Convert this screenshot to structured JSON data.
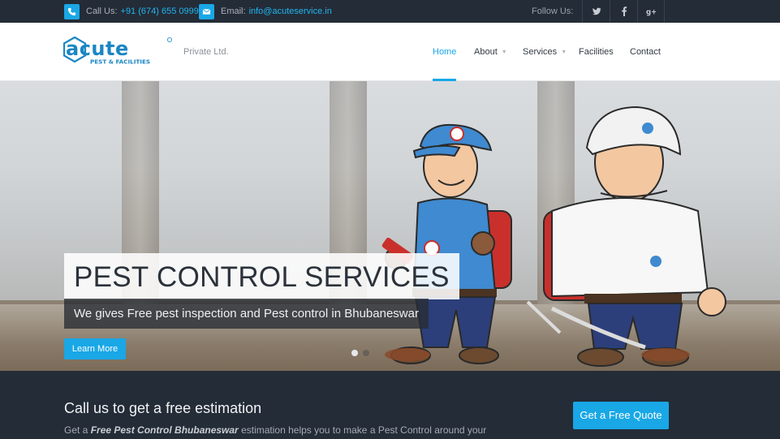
{
  "topbar": {
    "phone_label": "Call Us:",
    "phone_value": "+91 (674) 655 0999",
    "email_label": "Email:",
    "email_value": "info@acuteservice.in",
    "follow_label": "Follow Us:",
    "social_icons": [
      "twitter-icon",
      "facebook-icon",
      "google-plus-icon"
    ]
  },
  "header": {
    "logo_word": "acute",
    "logo_sub": "PEST & FACILITIES",
    "tagline": "Private Ltd.",
    "nav": [
      {
        "label": "Home",
        "active": true
      },
      {
        "label": "About",
        "dropdown": true
      },
      {
        "label": "Services",
        "dropdown": true
      },
      {
        "label": "Facilities"
      },
      {
        "label": "Contact"
      }
    ]
  },
  "hero": {
    "headline": "PEST CONTROL SERVICES",
    "subline": "We gives Free pest inspection and Pest control in Bhubaneswar",
    "button": "Learn More",
    "slides_total": 2,
    "active_slide": 1
  },
  "band": {
    "title": "Call us to get a free estimation",
    "desc_prefix": "Get a ",
    "desc_bold": "Free Pest Control Bhubaneswar",
    "desc_suffix": " estimation helps you to make a Pest Control around your",
    "button": "Get a Free Quote"
  },
  "colors": {
    "accent": "#19a7e6",
    "dark_bar": "#242c37",
    "logo_blue": "#1a86c4"
  }
}
